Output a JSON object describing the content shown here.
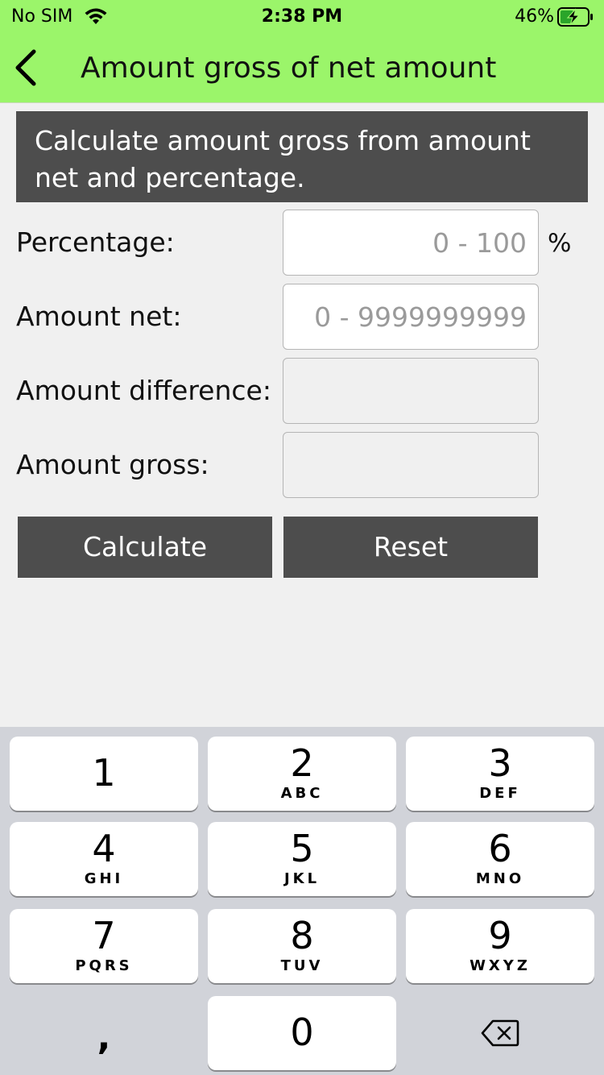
{
  "status_bar": {
    "carrier": "No SIM",
    "time": "2:38 PM",
    "battery_percent": "46%"
  },
  "nav": {
    "title": "Amount gross of net amount"
  },
  "banner": {
    "text": "Calculate amount gross from amount net and percentage."
  },
  "form": {
    "percentage_label": "Percentage:",
    "percentage_placeholder": "0 - 100",
    "percentage_unit": "%",
    "net_label": "Amount net:",
    "net_placeholder": "0 - 9999999999",
    "difference_label": "Amount difference:",
    "gross_label": "Amount gross:"
  },
  "buttons": {
    "calculate": "Calculate",
    "reset": "Reset"
  },
  "keyboard": {
    "keys": [
      {
        "digit": "1",
        "letters": ""
      },
      {
        "digit": "2",
        "letters": "ABC"
      },
      {
        "digit": "3",
        "letters": "DEF"
      },
      {
        "digit": "4",
        "letters": "GHI"
      },
      {
        "digit": "5",
        "letters": "JKL"
      },
      {
        "digit": "6",
        "letters": "MNO"
      },
      {
        "digit": "7",
        "letters": "PQRS"
      },
      {
        "digit": "8",
        "letters": "TUV"
      },
      {
        "digit": "9",
        "letters": "WXYZ"
      },
      {
        "digit": "0",
        "letters": ""
      }
    ],
    "comma": ","
  },
  "colors": {
    "header": "#9bf56a",
    "dark": "#4d4d4d"
  }
}
